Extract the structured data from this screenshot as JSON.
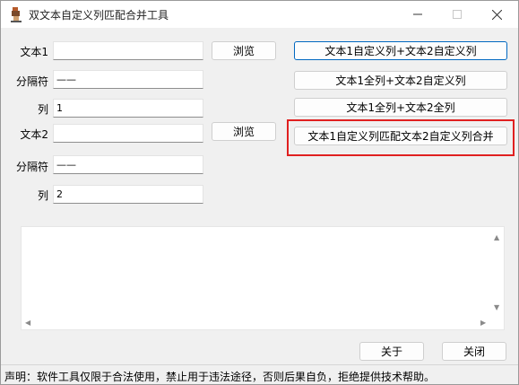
{
  "window": {
    "title": "双文本自定义列匹配合并工具",
    "app_icon": "app-logo-icon",
    "controls": [
      "minimize-icon",
      "maximize-icon",
      "close-icon"
    ]
  },
  "form": {
    "text1_label": "文本1",
    "text1_value": "",
    "sep1_label": "分隔符",
    "sep1_value": "——",
    "col1_label": "列",
    "col1_value": "1",
    "text2_label": "文本2",
    "text2_value": "",
    "sep2_label": "分隔符",
    "sep2_value": "——",
    "col2_label": "列",
    "col2_value": "2",
    "browse1_label": "浏览",
    "browse2_label": "浏览"
  },
  "actions": {
    "btn1": "文本1自定义列+文本2自定义列",
    "btn2": "文本1全列+文本2自定义列",
    "btn3": "文本1全列+文本2全列",
    "btn4": "文本1自定义列匹配文本2自定义列合并"
  },
  "log": {
    "content": ""
  },
  "footer": {
    "about_label": "关于",
    "close_label": "关闭"
  },
  "status": {
    "text": "声明：软件工具仅限于合法使用，禁止用于违法途径，否则后果自负，拒绝提供技术帮助。"
  },
  "colors": {
    "highlight": "#e02020",
    "primary_border": "#0067c0"
  }
}
